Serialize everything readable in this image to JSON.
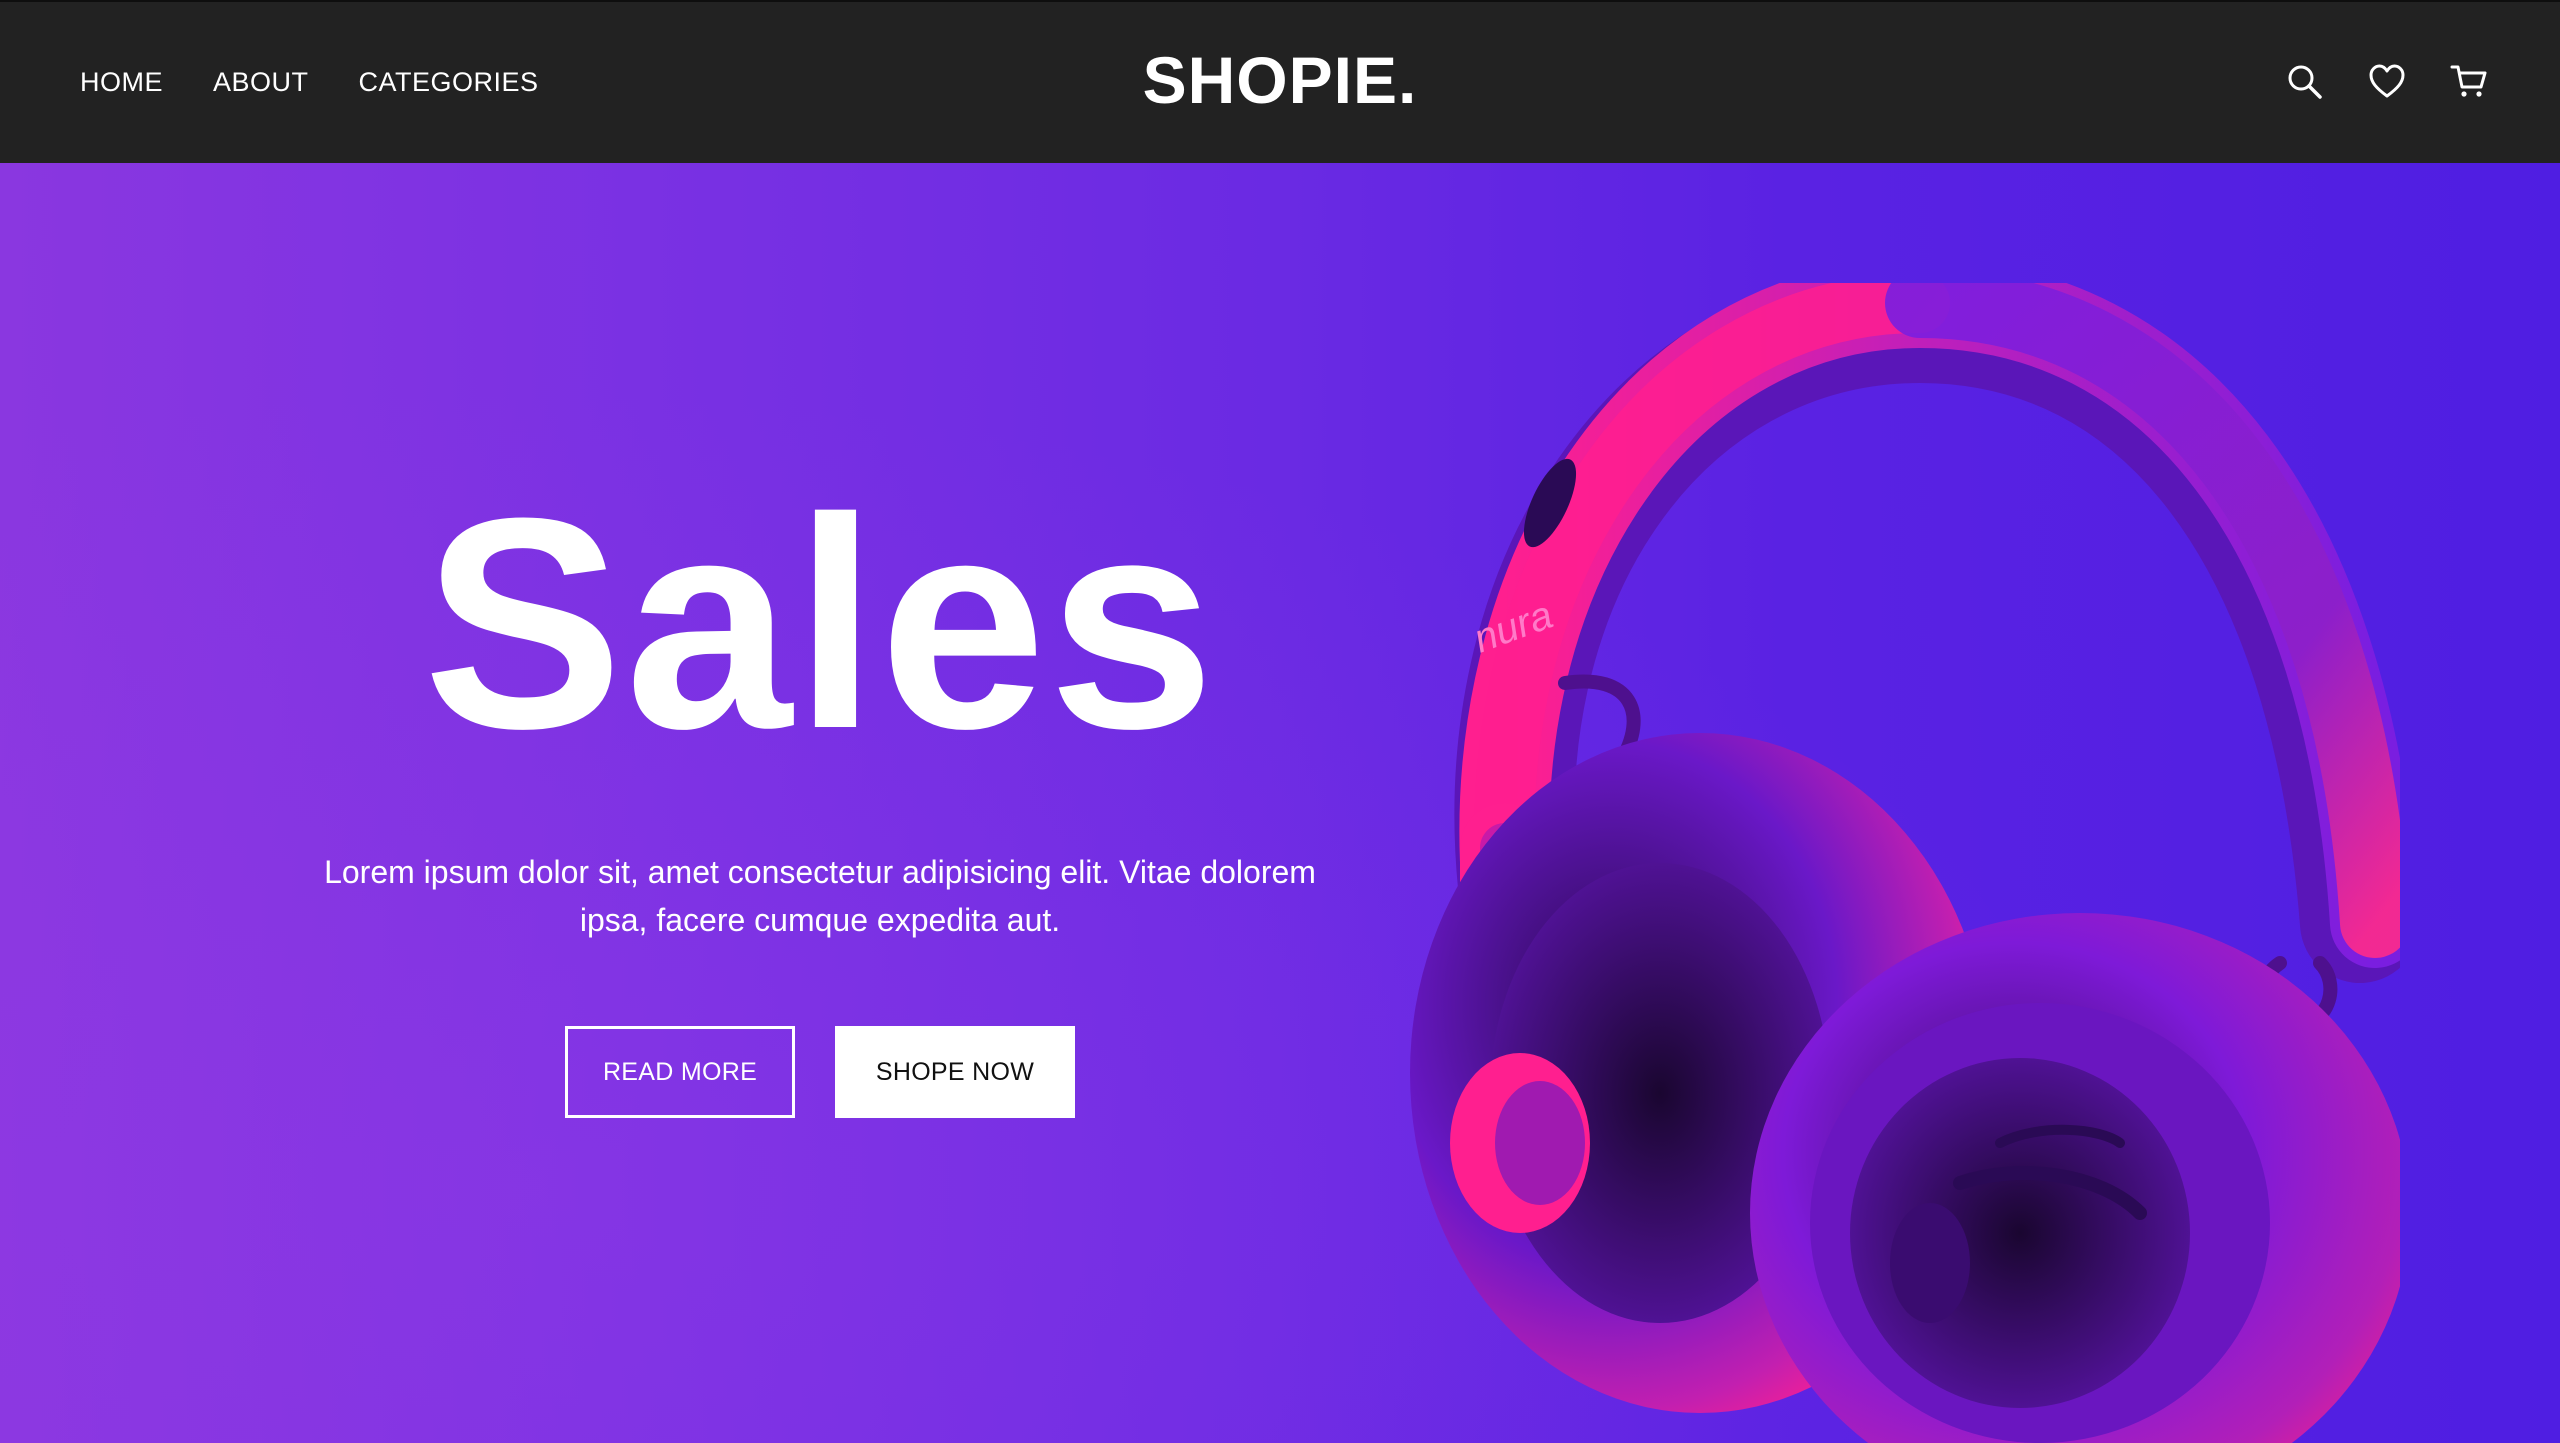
{
  "nav": {
    "links": [
      "HOME",
      "ABOUT",
      "CATEGORIES"
    ],
    "brand": "SHOPIE.",
    "icons": [
      "search-icon",
      "heart-icon",
      "cart-icon"
    ]
  },
  "hero": {
    "title": "Sales",
    "description": "Lorem ipsum dolor sit, amet consectetur adipisicing elit. Vitae dolorem ipsa, facere cumque expedita aut.",
    "read_more_label": "READ MORE",
    "shop_now_label": "SHOPE NOW",
    "product_brand_text": "nura"
  },
  "colors": {
    "navbar": "#222222",
    "hero_gradient_start": "#8a37e0",
    "hero_gradient_end": "#4f1ee2",
    "headphone_pink": "#ff1f8f",
    "headphone_purple": "#7a1ee0"
  }
}
